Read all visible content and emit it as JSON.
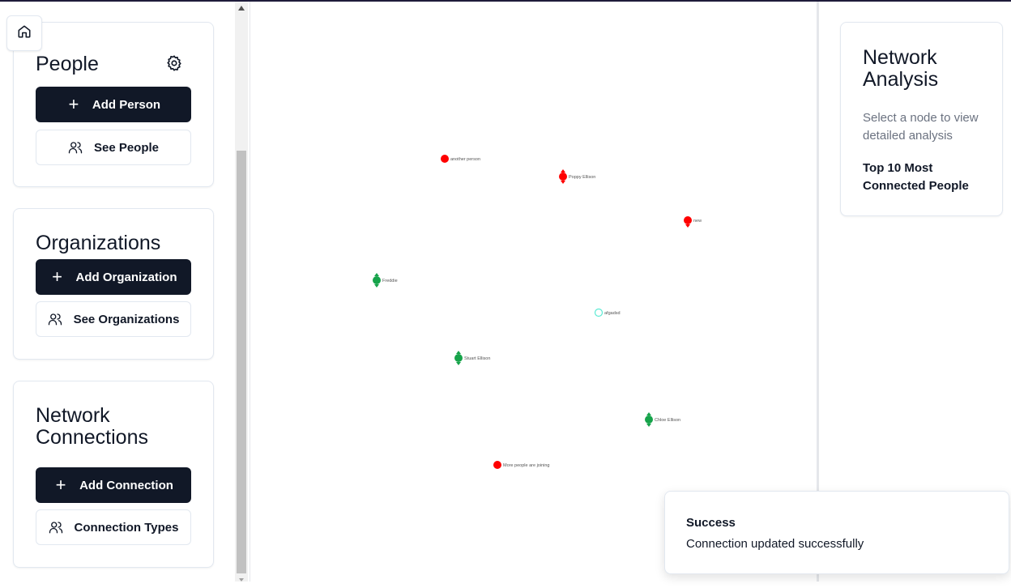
{
  "sidebar": {
    "people": {
      "title": "People",
      "add_label": "Add Person",
      "see_label": "See People"
    },
    "organizations": {
      "title": "Organizations",
      "add_label": "Add Organization",
      "see_label": "See Organizations"
    },
    "connections": {
      "title_line1": "Network",
      "title_line2": "Connections",
      "add_label": "Add Connection",
      "see_label": "Connection Types"
    }
  },
  "graph": {
    "nodes": [
      {
        "label": "another person",
        "color": "#ff0000",
        "shape": "dot"
      },
      {
        "label": "Poppy Ellison",
        "color": "#ff0000",
        "shape": "arrow"
      },
      {
        "label": "new",
        "color": "#ff0000",
        "shape": "arrow-down"
      },
      {
        "label": "Freddie",
        "color": "#16a34a",
        "shape": "arrow"
      },
      {
        "label": "afgadsd",
        "color": "#5eead4",
        "shape": "ring"
      },
      {
        "label": "Stuart Ellison",
        "color": "#16a34a",
        "shape": "arrow"
      },
      {
        "label": "Chloe Ellison",
        "color": "#16a34a",
        "shape": "arrow"
      },
      {
        "label": "More people are joining",
        "color": "#ff0000",
        "shape": "dot"
      }
    ]
  },
  "analysis": {
    "title_line1": "Network",
    "title_line2": "Analysis",
    "hint": "Select a node to view detailed analysis",
    "top10": "Top 10 Most Connected People"
  },
  "toast": {
    "title": "Success",
    "message": "Connection updated successfully"
  }
}
